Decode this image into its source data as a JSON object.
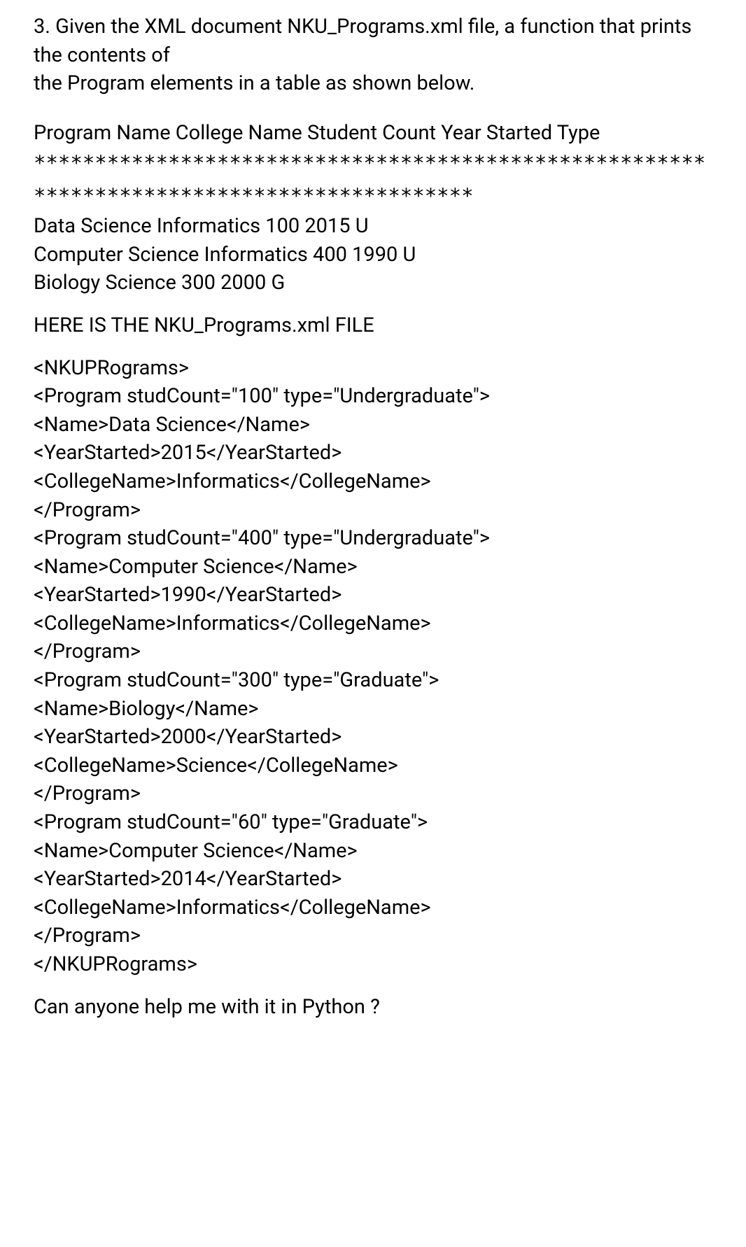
{
  "question": {
    "line1": "3. Given the XML document NKU_Programs.xml file, a function that prints the contents of",
    "line2": "the Program elements in a table as shown below."
  },
  "header": "Program Name College Name Student Count Year Started Type",
  "separator": "*******************************************************************************************",
  "data_rows": [
    "Data Science Informatics 100 2015 U",
    "Computer Science Informatics 400 1990 U",
    "Biology Science 300 2000 G"
  ],
  "file_label": "HERE IS THE NKU_Programs.xml FILE",
  "xml_lines": [
    "<NKUPRograms>",
    "<Program studCount=\"100\" type=\"Undergraduate\">",
    "<Name>Data Science</Name>",
    "<YearStarted>2015</YearStarted>",
    "<CollegeName>Informatics</CollegeName>",
    "</Program>",
    "<Program studCount=\"400\" type=\"Undergraduate\">",
    "<Name>Computer Science</Name>",
    "<YearStarted>1990</YearStarted>",
    "<CollegeName>Informatics</CollegeName>",
    "</Program>",
    "<Program studCount=\"300\" type=\"Graduate\">",
    "<Name>Biology</Name>",
    "<YearStarted>2000</YearStarted>",
    "<CollegeName>Science</CollegeName>",
    "</Program>",
    "<Program studCount=\"60\" type=\"Graduate\">",
    "<Name>Computer Science</Name>",
    "<YearStarted>2014</YearStarted>",
    "<CollegeName>Informatics</CollegeName>",
    "</Program>",
    "</NKUPRograms>"
  ],
  "final_question": "Can anyone help me with it in Python ?"
}
